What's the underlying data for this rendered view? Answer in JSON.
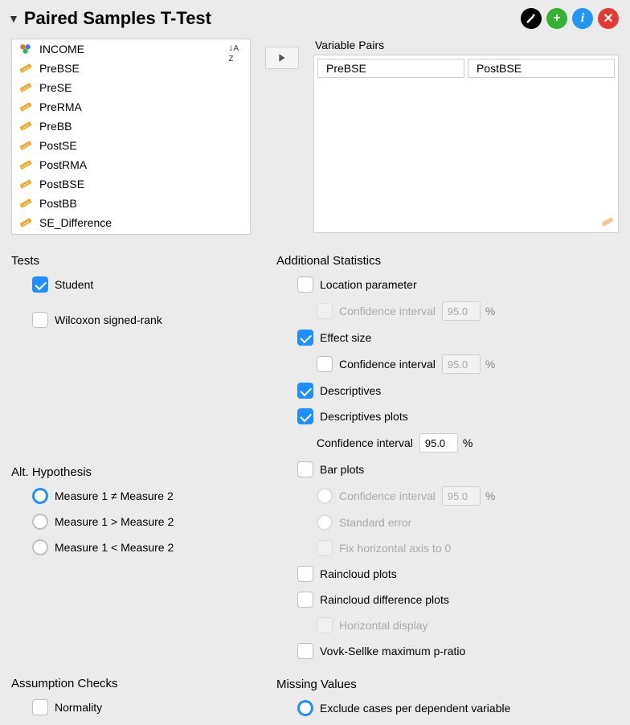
{
  "header": {
    "title": "Paired Samples T-Test"
  },
  "variables": {
    "sort_label": "↓A Z",
    "items": [
      {
        "name": "INCOME",
        "type": "nominal"
      },
      {
        "name": "PreBSE",
        "type": "scale"
      },
      {
        "name": "PreSE",
        "type": "scale"
      },
      {
        "name": "PreRMA",
        "type": "scale"
      },
      {
        "name": "PreBB",
        "type": "scale"
      },
      {
        "name": "PostSE",
        "type": "scale"
      },
      {
        "name": "PostRMA",
        "type": "scale"
      },
      {
        "name": "PostBSE",
        "type": "scale"
      },
      {
        "name": "PostBB",
        "type": "scale"
      },
      {
        "name": "SE_Difference",
        "type": "scale"
      }
    ]
  },
  "pairs": {
    "label": "Variable Pairs",
    "rows": [
      {
        "a": "PreBSE",
        "b": "PostBSE"
      }
    ]
  },
  "tests": {
    "title": "Tests",
    "student": {
      "label": "Student",
      "checked": true
    },
    "wilcoxon": {
      "label": "Wilcoxon signed-rank",
      "checked": false
    }
  },
  "alt": {
    "title": "Alt. Hypothesis",
    "opts": [
      {
        "label": "Measure 1 ≠ Measure 2",
        "selected": true
      },
      {
        "label": "Measure 1 > Measure 2",
        "selected": false
      },
      {
        "label": "Measure 1 < Measure 2",
        "selected": false
      }
    ]
  },
  "addstats": {
    "title": "Additional Statistics",
    "location": {
      "label": "Location parameter",
      "checked": false
    },
    "location_ci": {
      "label": "Confidence interval",
      "value": "95.0",
      "pct": "%",
      "disabled": true
    },
    "effect": {
      "label": "Effect size",
      "checked": true
    },
    "effect_ci": {
      "label": "Confidence interval",
      "value": "95.0",
      "pct": "%",
      "checked": false
    },
    "descriptives": {
      "label": "Descriptives",
      "checked": true
    },
    "descplots": {
      "label": "Descriptives plots",
      "checked": true
    },
    "descplots_ci": {
      "label": "Confidence interval",
      "value": "95.0",
      "pct": "%"
    },
    "barplots": {
      "label": "Bar plots",
      "checked": false
    },
    "barplots_ci": {
      "label": "Confidence interval",
      "value": "95.0",
      "pct": "%",
      "disabled": true
    },
    "barplots_se": {
      "label": "Standard error",
      "disabled": true
    },
    "barplots_fix0": {
      "label": "Fix horizontal axis to 0",
      "disabled": true
    },
    "rainclouds": {
      "label": "Raincloud plots",
      "checked": false
    },
    "rainclouds_diff": {
      "label": "Raincloud difference plots",
      "checked": false
    },
    "rainclouds_horiz": {
      "label": "Horizontal display",
      "disabled": true
    },
    "vovk": {
      "label": "Vovk-Sellke maximum p-ratio",
      "checked": false
    }
  },
  "assump": {
    "title": "Assumption Checks",
    "normality": {
      "label": "Normality",
      "checked": false
    }
  },
  "missing": {
    "title": "Missing Values",
    "exclude_dep": {
      "label": "Exclude cases per dependent variable",
      "selected": true
    }
  }
}
